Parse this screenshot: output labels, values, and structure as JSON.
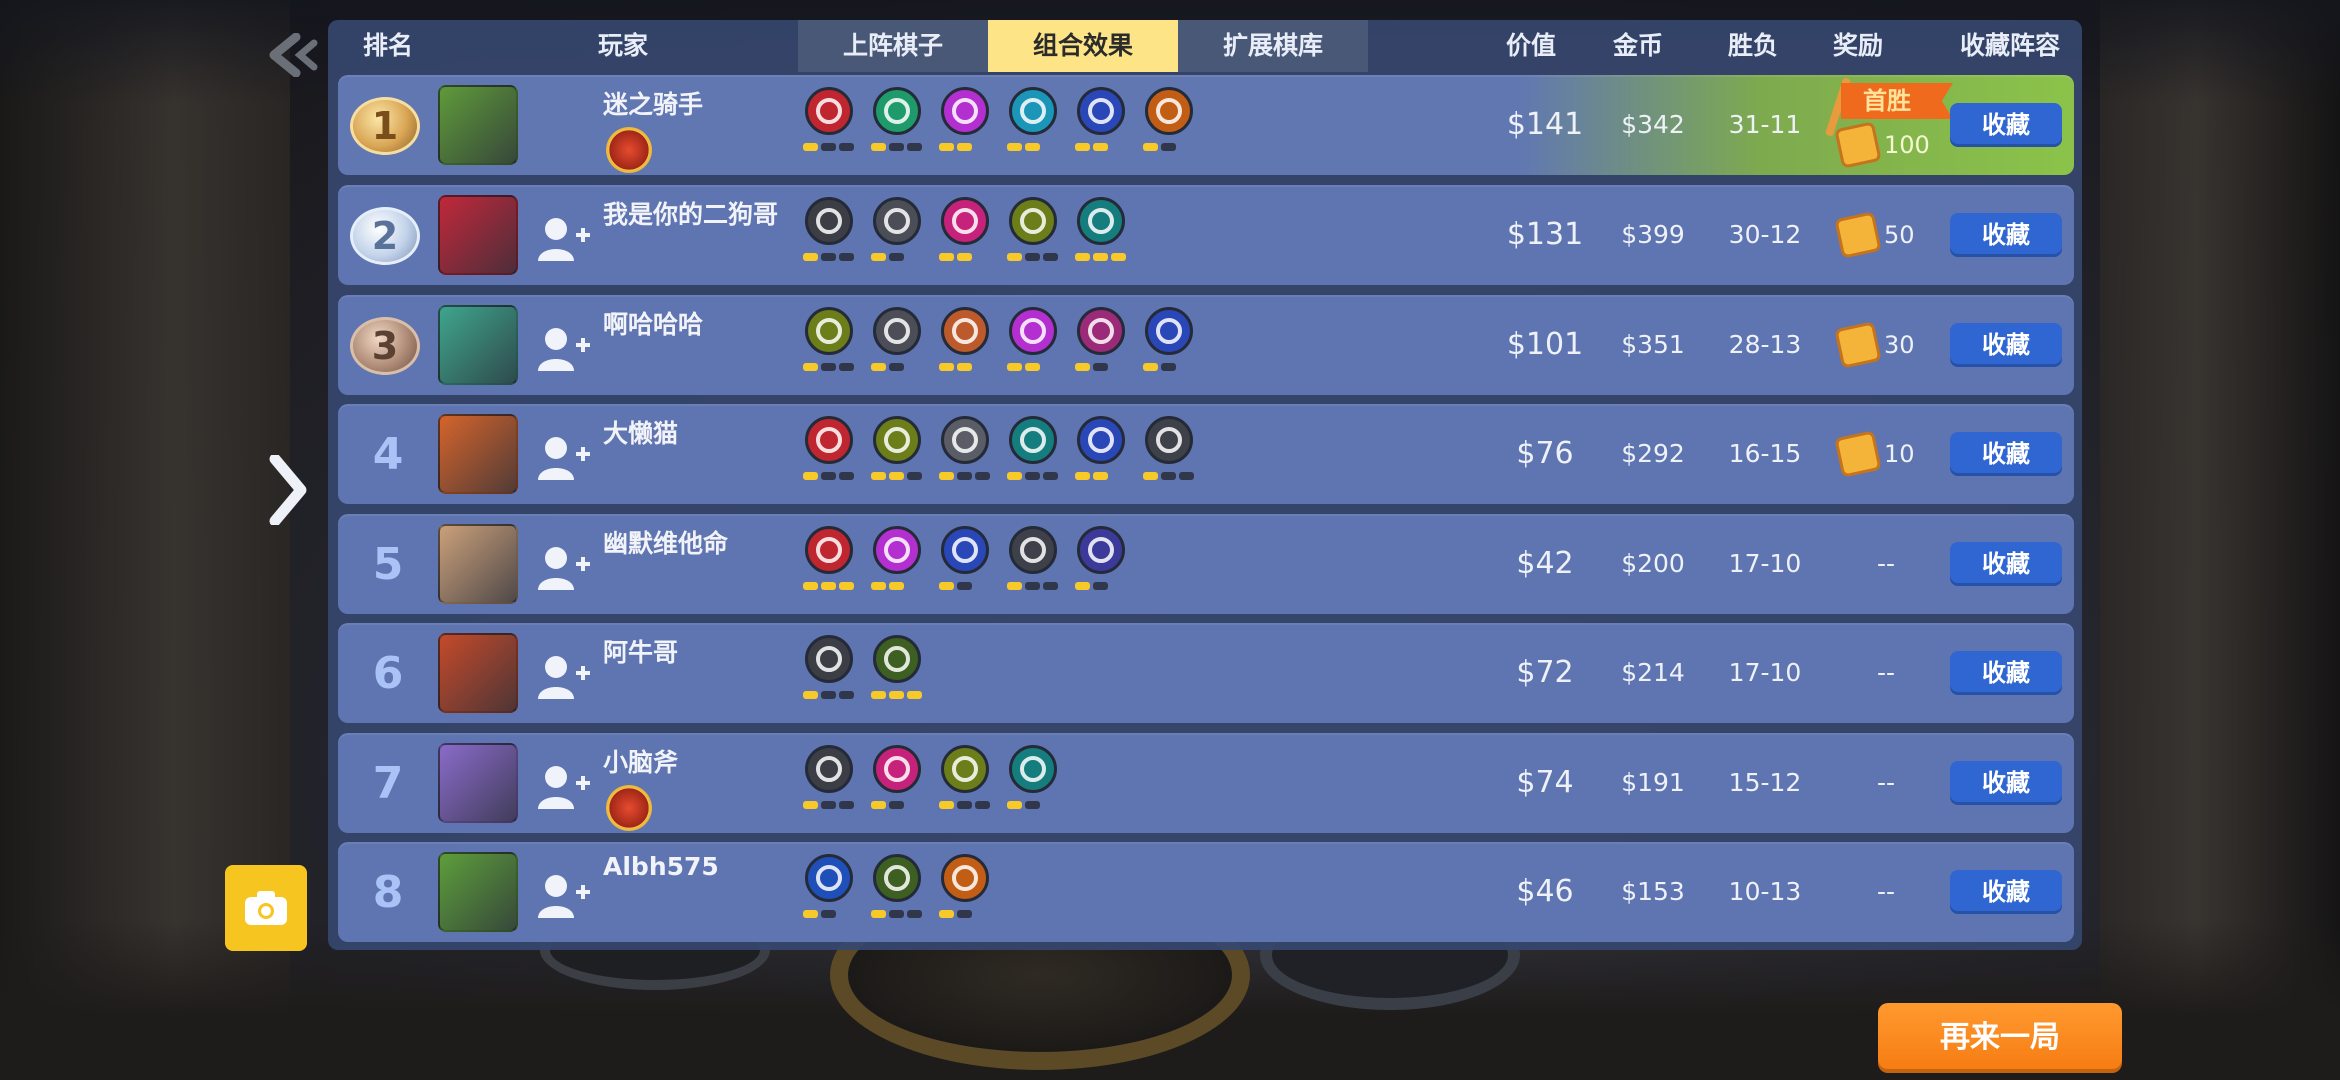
{
  "header": {
    "rank": "排名",
    "player": "玩家",
    "tabs": [
      {
        "label": "上阵棋子",
        "active": false
      },
      {
        "label": "组合效果",
        "active": true
      },
      {
        "label": "扩展棋库",
        "active": false
      }
    ],
    "price": "价值",
    "gold": "金币",
    "winloss": "胜负",
    "reward": "奖励",
    "collect": "收藏阵容"
  },
  "first_win_label": "首胜",
  "collect_label": "收藏",
  "play_again_label": "再来一局",
  "icons": {
    "back": "back-chevron-icon",
    "side": "expand-chevron-icon",
    "camera": "camera-icon",
    "add_friend": "add-friend-icon",
    "reward": "cookie-icon"
  },
  "colors": {
    "active_tab": "#fde587",
    "row": "#5f75b1",
    "collect_button": "#2f66d1",
    "play_again": "#f57b12",
    "pip_on": "#f7ca2a"
  },
  "rows": [
    {
      "rank": "1",
      "medal": "gold",
      "name": "迷之骑手",
      "add_friend": false,
      "title_badge": true,
      "avatar_color": "#5f9a3a",
      "traits": [
        {
          "color": "#c0262f",
          "pips": [
            1,
            0,
            0
          ]
        },
        {
          "color": "#1f9a6b",
          "pips": [
            1,
            0,
            0
          ]
        },
        {
          "color": "#b32fd0",
          "pips": [
            1,
            1
          ]
        },
        {
          "color": "#1b95b8",
          "pips": [
            1,
            1
          ]
        },
        {
          "color": "#2a47b8",
          "pips": [
            1,
            1
          ]
        },
        {
          "color": "#c25d16",
          "pips": [
            1,
            0
          ]
        }
      ],
      "price": "$141",
      "gold": "$342",
      "wl": "31-11",
      "reward": "100",
      "first_win": true
    },
    {
      "rank": "2",
      "medal": "silver",
      "name": "我是你的二狗哥",
      "add_friend": true,
      "title_badge": false,
      "avatar_color": "#c0283a",
      "traits": [
        {
          "color": "#3b3e45",
          "pips": [
            1,
            0,
            0
          ]
        },
        {
          "color": "#4b4e57",
          "pips": [
            1,
            0
          ]
        },
        {
          "color": "#c7227b",
          "pips": [
            1,
            1
          ]
        },
        {
          "color": "#6b7e19",
          "pips": [
            1,
            0,
            0
          ]
        },
        {
          "color": "#167d7f",
          "pips": [
            1,
            1,
            1
          ]
        }
      ],
      "price": "$131",
      "gold": "$399",
      "wl": "30-12",
      "reward": "50",
      "first_win": false
    },
    {
      "rank": "3",
      "medal": "bronze",
      "name": "啊哈哈哈",
      "add_friend": true,
      "title_badge": false,
      "avatar_color": "#3ea58c",
      "traits": [
        {
          "color": "#6b7e19",
          "pips": [
            1,
            0,
            0
          ]
        },
        {
          "color": "#4b4e57",
          "pips": [
            1,
            0
          ]
        },
        {
          "color": "#bd5a2b",
          "pips": [
            1,
            1
          ]
        },
        {
          "color": "#b32fd0",
          "pips": [
            1,
            1
          ]
        },
        {
          "color": "#9b2a78",
          "pips": [
            1,
            0
          ]
        },
        {
          "color": "#2a47b8",
          "pips": [
            1,
            0
          ]
        }
      ],
      "price": "$101",
      "gold": "$351",
      "wl": "28-13",
      "reward": "30",
      "first_win": false
    },
    {
      "rank": "4",
      "medal": "",
      "name": "大懒猫",
      "add_friend": true,
      "title_badge": false,
      "avatar_color": "#d4642c",
      "traits": [
        {
          "color": "#c0262f",
          "pips": [
            1,
            0,
            0
          ]
        },
        {
          "color": "#6b7e19",
          "pips": [
            1,
            1,
            0
          ]
        },
        {
          "color": "#5a5d66",
          "pips": [
            1,
            0,
            0
          ]
        },
        {
          "color": "#167d7f",
          "pips": [
            1,
            0,
            0
          ]
        },
        {
          "color": "#2a47b8",
          "pips": [
            1,
            1
          ]
        },
        {
          "color": "#3e4149",
          "pips": [
            1,
            0,
            0
          ]
        }
      ],
      "price": "$76",
      "gold": "$292",
      "wl": "16-15",
      "reward": "10",
      "first_win": false
    },
    {
      "rank": "5",
      "medal": "",
      "name": "幽默维他命",
      "add_friend": true,
      "title_badge": false,
      "avatar_color": "#caa07a",
      "traits": [
        {
          "color": "#c0262f",
          "pips": [
            1,
            1,
            1
          ]
        },
        {
          "color": "#b32fd0",
          "pips": [
            1,
            1
          ]
        },
        {
          "color": "#2a47b8",
          "pips": [
            1,
            0
          ]
        },
        {
          "color": "#3e4149",
          "pips": [
            1,
            0,
            0
          ]
        },
        {
          "color": "#3b3a9a",
          "pips": [
            1,
            0
          ]
        }
      ],
      "price": "$42",
      "gold": "$200",
      "wl": "17-10",
      "reward": "--",
      "first_win": false
    },
    {
      "rank": "6",
      "medal": "",
      "name": "阿牛哥",
      "add_friend": true,
      "title_badge": false,
      "avatar_color": "#c44a2a",
      "traits": [
        {
          "color": "#3b3e45",
          "pips": [
            1,
            0,
            0
          ]
        },
        {
          "color": "#3d5f21",
          "pips": [
            1,
            1,
            1
          ]
        }
      ],
      "price": "$72",
      "gold": "$214",
      "wl": "17-10",
      "reward": "--",
      "first_win": false
    },
    {
      "rank": "7",
      "medal": "",
      "name": "小脑斧",
      "add_friend": true,
      "title_badge": true,
      "avatar_color": "#8a6bc9",
      "traits": [
        {
          "color": "#3b3e45",
          "pips": [
            1,
            0,
            0
          ]
        },
        {
          "color": "#c7227b",
          "pips": [
            1,
            0
          ]
        },
        {
          "color": "#6b7e19",
          "pips": [
            1,
            0,
            0
          ]
        },
        {
          "color": "#167d7f",
          "pips": [
            1,
            0
          ]
        }
      ],
      "price": "$74",
      "gold": "$191",
      "wl": "15-12",
      "reward": "--",
      "first_win": false
    },
    {
      "rank": "8",
      "medal": "",
      "name": "Albh575",
      "add_friend": true,
      "title_badge": false,
      "avatar_color": "#5d9e3b",
      "traits": [
        {
          "color": "#1f4fb8",
          "pips": [
            1,
            0
          ]
        },
        {
          "color": "#3d5f21",
          "pips": [
            1,
            0,
            0
          ]
        },
        {
          "color": "#c25d16",
          "pips": [
            1,
            0
          ]
        }
      ],
      "price": "$46",
      "gold": "$153",
      "wl": "10-13",
      "reward": "--",
      "first_win": false
    }
  ]
}
